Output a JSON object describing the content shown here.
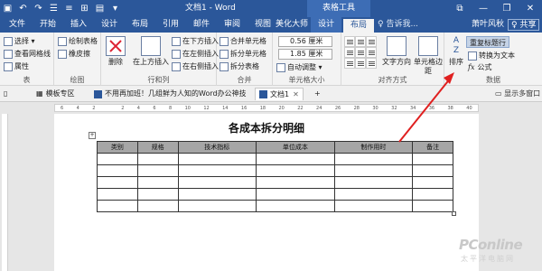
{
  "titlebar": {
    "doc_title": "文档1 - Word",
    "context_title": "表格工具",
    "controls": [
      "—",
      "❐",
      "✕"
    ],
    "qat_icons": [
      "save-icon",
      "undo-icon",
      "redo-icon",
      "bullet-list-icon",
      "numbered-list-icon",
      "grid-icon",
      "file-icon",
      "customize-qat-icon"
    ]
  },
  "tabs": {
    "file": "文件",
    "items": [
      "开始",
      "插入",
      "设计",
      "布局",
      "引用",
      "邮件",
      "审阅",
      "视图",
      "美化大师"
    ],
    "context": [
      "设计",
      "布局"
    ],
    "active": "布局",
    "tell_me": "♀ 告诉我...",
    "user": "萧叶风秋",
    "share": "♀ 共享"
  },
  "ribbon": {
    "table_group": {
      "label": "表",
      "items": [
        "选择 ▾",
        "查看网格线",
        "属性"
      ]
    },
    "draw_group": {
      "label": "绘图",
      "items": [
        "绘制表格",
        "橡皮擦"
      ]
    },
    "delete_button": "删除",
    "rows_cols_group": {
      "label": "行和列",
      "insert_above": "在上方插入",
      "items": [
        "在下方插入",
        "在左侧插入",
        "在右侧插入"
      ]
    },
    "merge_group": {
      "label": "合并",
      "items": [
        "合并单元格",
        "拆分单元格",
        "拆分表格"
      ]
    },
    "cell_size_group": {
      "label": "单元格大小",
      "height": "0.56 厘米",
      "width": "1.85 厘米",
      "autofit": "自动调整 ▾"
    },
    "alignment_group": {
      "label": "对齐方式",
      "text_direction": "文字方向",
      "cell_margins": "单元格边距"
    },
    "data_group": {
      "label": "数据",
      "sort": "排序",
      "repeat_header": "重复标题行",
      "convert_text": "转换为文本",
      "formula": "公式"
    }
  },
  "doc_tabs": {
    "template": "模板专区",
    "article": "不用再加班！几组鲜为人知的Word办公神技",
    "active": "文档1",
    "more_windows": "显示多窗口"
  },
  "ruler_ticks": [
    "6",
    "4",
    "2",
    "",
    "2",
    "4",
    "6",
    "8",
    "10",
    "12",
    "14",
    "16",
    "18",
    "20",
    "22",
    "24",
    "26",
    "28",
    "30",
    "32",
    "34",
    "36",
    "38",
    "40"
  ],
  "document": {
    "heading": "各成本拆分明细",
    "table_headers": [
      "类别",
      "规格",
      "技术指标",
      "单位成本",
      "制作用时",
      "备注"
    ],
    "empty_rows": 5
  },
  "watermark": {
    "brand": "PConline",
    "sub": "太平洋电脑网"
  },
  "colors": {
    "word_blue": "#2b579a",
    "context_blue": "#3d6db5",
    "arrow_red": "#e02020",
    "header_gray": "#a6a6a6"
  }
}
